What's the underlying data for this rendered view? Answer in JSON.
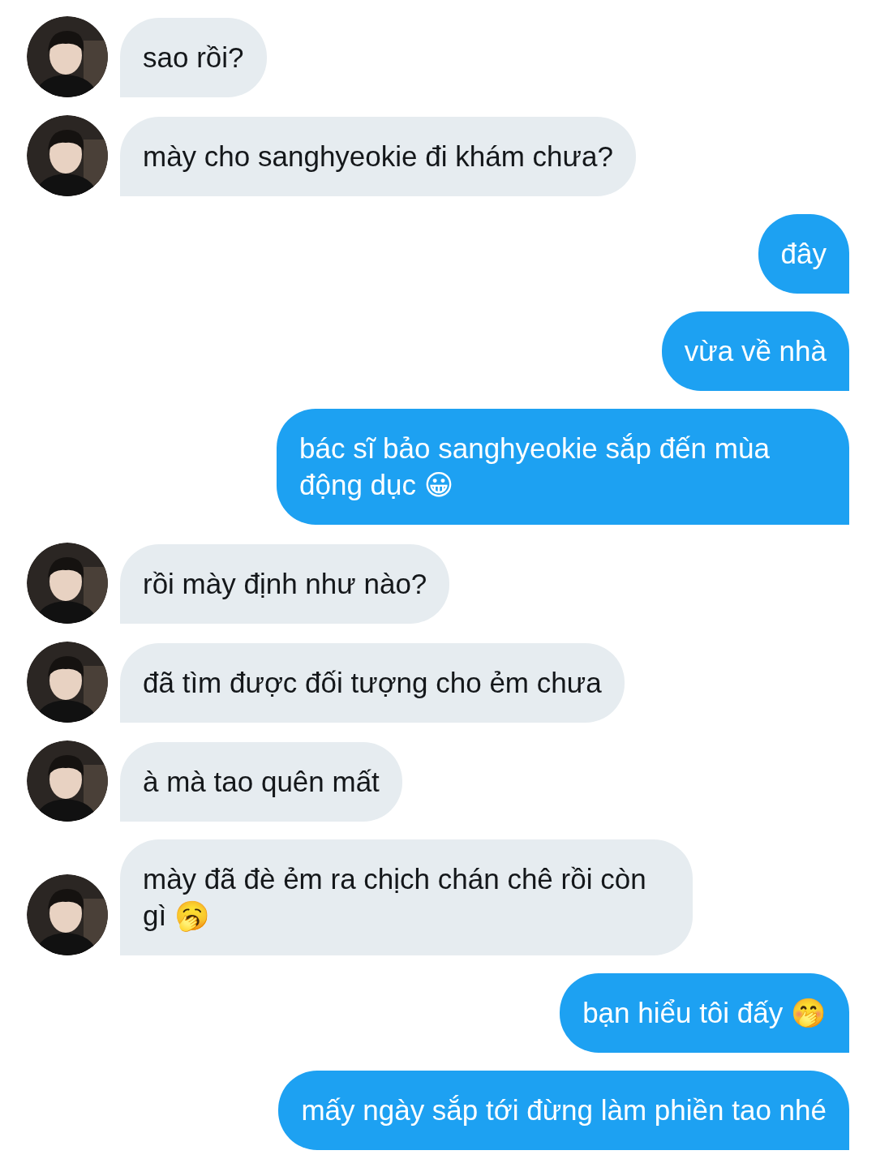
{
  "messages": [
    {
      "kind": "incoming",
      "text": "sao rồi?"
    },
    {
      "kind": "incoming",
      "text": "mày cho sanghyeokie đi khám chưa?"
    },
    {
      "kind": "outgoing",
      "text": "đây"
    },
    {
      "kind": "outgoing",
      "text": "vừa về nhà"
    },
    {
      "kind": "outgoing",
      "text": "bác sĩ bảo sanghyeokie sắp đến mùa động dục 😀"
    },
    {
      "kind": "incoming",
      "text": "rồi mày định như nào?"
    },
    {
      "kind": "incoming",
      "text": "đã tìm được đối tượng cho ẻm chưa"
    },
    {
      "kind": "incoming",
      "text": "à mà tao quên mất"
    },
    {
      "kind": "incoming",
      "text": "mày đã đè ẻm ra chịch chán chê rồi còn gì 🥱"
    },
    {
      "kind": "outgoing",
      "text": "bạn hiểu tôi đấy 🤭"
    },
    {
      "kind": "outgoing",
      "text": "mấy ngày sắp tới đừng làm phiền tao nhé"
    }
  ]
}
